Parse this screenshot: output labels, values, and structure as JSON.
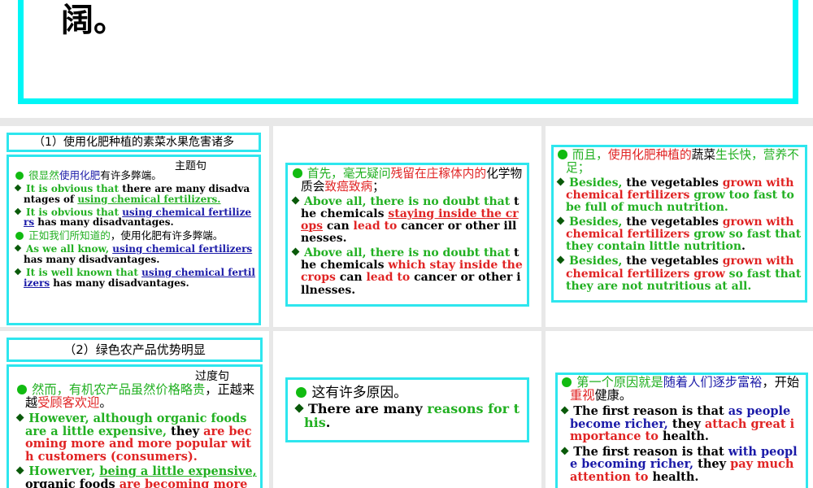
{
  "colors": {
    "g": "#22b022",
    "r": "#e02424",
    "b": "#1a1aa8",
    "k": "#000000"
  },
  "top": {
    "text": "阔。"
  },
  "s1": {
    "title": "（1）使用化肥种植的素菜水果危害诸多",
    "label": "主题句",
    "paras": [
      {
        "zh": 1,
        "bul": "circle",
        "segs": [
          [
            "很显然",
            "g"
          ],
          [
            "使用化肥",
            "b"
          ],
          [
            "有许多弊端。",
            "k"
          ]
        ]
      },
      {
        "bul": "diamond",
        "segs": [
          [
            "It is obvious that ",
            "g"
          ],
          [
            "there are many disadvantages of ",
            "k"
          ],
          [
            "using chemical fertilizers.",
            "g",
            1
          ]
        ]
      },
      {
        "bul": "diamond",
        "segs": [
          [
            "It is obvious that ",
            "g"
          ],
          [
            "using chemical fertilizers",
            "b",
            1
          ],
          [
            " has many disadvantages.",
            "k"
          ]
        ]
      },
      {
        "zh": 1,
        "bul": "circle",
        "segs": [
          [
            "正如我们所知道的",
            "g"
          ],
          [
            "，使用化肥有许多弊端。",
            "k"
          ]
        ]
      },
      {
        "bul": "diamond",
        "segs": [
          [
            "As we all know, ",
            "g"
          ],
          [
            "using chemical fertilizers",
            "b",
            1
          ],
          [
            " has many disadvantages.",
            "k"
          ]
        ]
      },
      {
        "bul": "diamond",
        "segs": [
          [
            "It is well known that ",
            "g"
          ],
          [
            "using chemical fertilizers",
            "b",
            1
          ],
          [
            " has many disadvantages.",
            "k"
          ]
        ]
      }
    ]
  },
  "s2": {
    "paras": [
      {
        "zh": 1,
        "bul": "circle",
        "segs": [
          [
            "首先，毫无疑问",
            "g"
          ],
          [
            "残留在庄稼体内的",
            "r"
          ],
          [
            "化学物质会",
            "k"
          ],
          [
            "致癌致病",
            "r"
          ],
          [
            "；",
            "k"
          ]
        ]
      },
      {
        "bul": "diamond",
        "segs": [
          [
            "Above all, there is no doubt that ",
            "g"
          ],
          [
            "the chemicals ",
            "k"
          ],
          [
            "staying inside the crops",
            "r",
            1
          ],
          [
            " can ",
            "k"
          ],
          [
            "lead to",
            "r"
          ],
          [
            " cancer or other illnesses.",
            "k"
          ]
        ]
      },
      {
        "bul": "diamond",
        "segs": [
          [
            "Above all, there is no doubt that ",
            "g"
          ],
          [
            "the chemicals ",
            "k"
          ],
          [
            "which stay inside the crops",
            "r"
          ],
          [
            " can ",
            "k"
          ],
          [
            "lead to",
            "r"
          ],
          [
            " cancer or other illnesses.",
            "k"
          ]
        ]
      }
    ]
  },
  "s3": {
    "paras": [
      {
        "zh": 1,
        "bul": "circle",
        "segs": [
          [
            "而且，",
            "g"
          ],
          [
            "使用化肥种植的",
            "r"
          ],
          [
            "蔬菜",
            "k"
          ],
          [
            "生长快，营养不足；",
            "g"
          ]
        ]
      },
      {
        "bul": "diamond",
        "segs": [
          [
            "Besides, ",
            "g"
          ],
          [
            "the vegetables ",
            "k"
          ],
          [
            "grown with chemical fertilizers",
            "r"
          ],
          [
            " grow too fast to be full of much nutrition.",
            "g"
          ]
        ]
      },
      {
        "bul": "diamond",
        "segs": [
          [
            "Besides, ",
            "g"
          ],
          [
            "the vegetables ",
            "k"
          ],
          [
            "grown with chemical fertilizers",
            "r"
          ],
          [
            " grow so fast that they contain little nutrition",
            "g"
          ],
          [
            ".",
            "k"
          ]
        ]
      },
      {
        "bul": "diamond",
        "segs": [
          [
            "Besides, ",
            "g"
          ],
          [
            "the vegetables ",
            "k"
          ],
          [
            "grown with chemical fertilizers grow",
            "r"
          ],
          [
            " so fast that they are not nutritious at all.",
            "g"
          ]
        ]
      }
    ]
  },
  "s4": {
    "title": "（2）绿色农产品优势明显",
    "label": "过度句",
    "paras": [
      {
        "zh": 1,
        "bul": "circle",
        "segs": [
          [
            "然而，有机农产品虽然价格略贵",
            "g"
          ],
          [
            "，正越来越",
            "k"
          ],
          [
            "受顾客欢迎",
            "r"
          ],
          [
            "。",
            "k"
          ]
        ]
      },
      {
        "bul": "diamond",
        "segs": [
          [
            "However, although organic foods are a little expensive, ",
            "g"
          ],
          [
            "they ",
            "k"
          ],
          [
            "are becoming more and more popular with customers (consumers).",
            "r"
          ]
        ]
      },
      {
        "bul": "diamond",
        "segs": [
          [
            "Howerver, ",
            "g"
          ],
          [
            "being a little expensive,",
            "g",
            1
          ],
          [
            " organic foods ",
            "k"
          ],
          [
            "are becoming more and more popular",
            "r"
          ]
        ]
      }
    ]
  },
  "s5": {
    "paras": [
      {
        "zh": 1,
        "bul": "circle",
        "segs": [
          [
            "这有许多原因。",
            "k"
          ]
        ]
      },
      {
        "bul": "diamond",
        "segs": [
          [
            "There are many ",
            "k"
          ],
          [
            "reasons for this",
            "g"
          ],
          [
            ".",
            "k"
          ]
        ]
      }
    ]
  },
  "s6": {
    "paras": [
      {
        "zh": 1,
        "bul": "circle",
        "segs": [
          [
            "第一个原因就是",
            "g"
          ],
          [
            "随着人们逐步富裕",
            "b"
          ],
          [
            "，开始",
            "k"
          ],
          [
            "重视",
            "r"
          ],
          [
            "健康。",
            "k"
          ]
        ]
      },
      {
        "bul": "diamond",
        "segs": [
          [
            "The first reason is that ",
            "k"
          ],
          [
            "as people become richer,",
            "b"
          ],
          [
            " they ",
            "k"
          ],
          [
            "attach great importance to",
            "r"
          ],
          [
            " health.",
            "k"
          ]
        ]
      },
      {
        "bul": "diamond",
        "segs": [
          [
            "The first reason is that ",
            "k"
          ],
          [
            "with people becoming richer,",
            "b"
          ],
          [
            " they ",
            "k"
          ],
          [
            "pay much attention to",
            "r"
          ],
          [
            " health.",
            "k"
          ]
        ]
      }
    ]
  }
}
